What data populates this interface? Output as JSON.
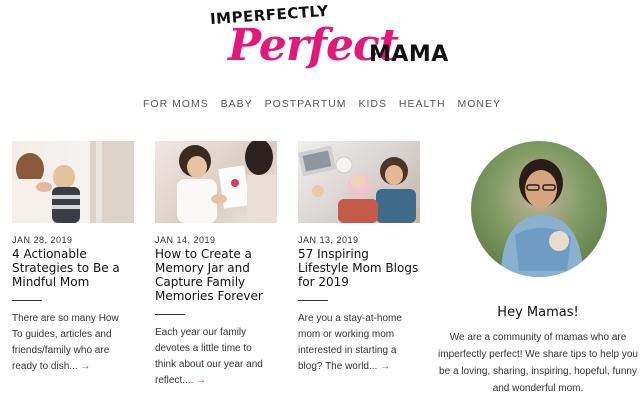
{
  "logo": {
    "top": "IMPERFECTLY",
    "script": "Perfect",
    "suffix": "MAMA"
  },
  "nav": [
    "FOR MOMS",
    "BABY",
    "POSTPARTUM",
    "KIDS",
    "HEALTH",
    "MONEY"
  ],
  "posts": [
    {
      "date": "JAN 28, 2019",
      "title": "4 Actionable Strategies to Be a Mindful Mom",
      "excerpt": "There are so many How To guides, articles and friends/family who are ready to dish...",
      "arrow": "→"
    },
    {
      "date": "JAN 14, 2019",
      "title": "How to Create a Memory Jar and Capture Family Memories Forever",
      "excerpt": "Each year our family devotes a little time to think about our year and reflect....",
      "arrow": "→"
    },
    {
      "date": "JAN 13, 2019",
      "title": "57 Inspiring Lifestyle Mom Blogs for 2019",
      "excerpt": "Are you a stay-at-home mom or working mom interested in starting a blog? The world...",
      "arrow": "→"
    }
  ],
  "sidebar": {
    "heading": "Hey Mamas!",
    "text": "We are a community of mamas who are imperfectly perfect! We share tips to help you be a loving, sharing, inspiring, hopeful, funny and wonderful mom."
  },
  "colors": {
    "accent": "#e6177a",
    "text": "#222222"
  }
}
